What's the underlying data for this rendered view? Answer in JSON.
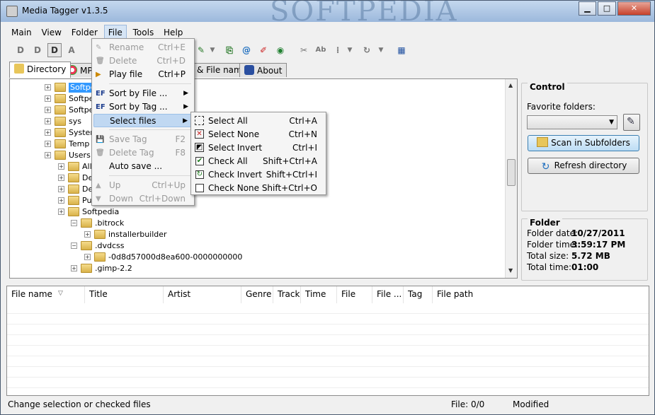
{
  "window": {
    "title": "Media Tagger v1.3.5",
    "watermark": "SOFTPEDIA"
  },
  "menubar": [
    "Main",
    "View",
    "Folder",
    "File",
    "Tools",
    "Help"
  ],
  "tabs": [
    {
      "label": "Directory",
      "icon": "folder-tab-icon"
    },
    {
      "label": "MP",
      "icon": "mp3-tab-icon"
    },
    {
      "label": "& File name",
      "icon": ""
    },
    {
      "label": "About",
      "icon": "gear-icon"
    }
  ],
  "tree": [
    {
      "label": "Softpe",
      "level": 0,
      "selected": true
    },
    {
      "label": "Softpe",
      "level": 0
    },
    {
      "label": "Softpe",
      "level": 0
    },
    {
      "label": "sys",
      "level": 0
    },
    {
      "label": "System",
      "level": 0
    },
    {
      "label": "Temp",
      "level": 0
    },
    {
      "label": "Users",
      "level": 0
    },
    {
      "label": "All",
      "level": 1
    },
    {
      "label": "De",
      "level": 1
    },
    {
      "label": "De",
      "level": 1
    },
    {
      "label": "Pu",
      "level": 1
    },
    {
      "label": "Softpedia",
      "level": 1
    },
    {
      "label": ".bitrock",
      "level": 2
    },
    {
      "label": "installerbuilder",
      "level": 3
    },
    {
      "label": ".dvdcss",
      "level": 2
    },
    {
      "label": "-0d8d57000d8ea600-0000000000",
      "level": 3
    },
    {
      "label": ".gimp-2.2",
      "level": 2
    }
  ],
  "control": {
    "title": "Control",
    "favorite_label": "Favorite folders:",
    "favorite_value": "",
    "scan_button": "Scan in Subfolders",
    "refresh_button": "Refresh directory"
  },
  "folder": {
    "title": "Folder",
    "rows": [
      {
        "label": "Folder date:",
        "value": "10/27/2011"
      },
      {
        "label": "Folder time:",
        "value": "3:59:17 PM"
      },
      {
        "label": "Total size:",
        "value": "5.72 MB"
      },
      {
        "label": "Total time:",
        "value": "01:00"
      }
    ]
  },
  "file_columns": [
    "File name",
    "Title",
    "Artist",
    "Genre",
    "Track",
    "Time",
    "File size",
    "File ...",
    "Tag",
    "File path"
  ],
  "file_menu": [
    {
      "label": "Rename",
      "shortcut": "Ctrl+E",
      "disabled": true
    },
    {
      "label": "Delete",
      "shortcut": "Ctrl+D",
      "disabled": true
    },
    {
      "label": "Play file",
      "shortcut": "Ctrl+P",
      "disabled": false
    },
    {
      "label": "Sort by File ...",
      "shortcut": "",
      "disabled": false,
      "submenu": true
    },
    {
      "label": "Sort by Tag ...",
      "shortcut": "",
      "disabled": false,
      "submenu": true
    },
    {
      "label": "Select files",
      "shortcut": "",
      "disabled": false,
      "submenu": true,
      "highlight": true
    },
    {
      "label": "Save Tag",
      "shortcut": "F2",
      "disabled": true
    },
    {
      "label": "Delete Tag",
      "shortcut": "F8",
      "disabled": true
    },
    {
      "label": "Auto save ...",
      "shortcut": "",
      "disabled": false
    },
    {
      "label": "Up",
      "shortcut": "Ctrl+Up",
      "disabled": true
    },
    {
      "label": "Down",
      "shortcut": "Ctrl+Down",
      "disabled": true
    }
  ],
  "select_submenu": [
    {
      "label": "Select All",
      "shortcut": "Ctrl+A"
    },
    {
      "label": "Select None",
      "shortcut": "Ctrl+N"
    },
    {
      "label": "Select Invert",
      "shortcut": "Ctrl+I"
    },
    {
      "label": "Check All",
      "shortcut": "Shift+Ctrl+A"
    },
    {
      "label": "Check Invert",
      "shortcut": "Shift+Ctrl+I"
    },
    {
      "label": "Check None",
      "shortcut": "Shift+Ctrl+O"
    }
  ],
  "status": {
    "message": "Change selection or checked files",
    "file_count": "File: 0/0",
    "modified": "Modified"
  },
  "colors": {
    "accent": "#3399ff",
    "highlight": "#c0d8f2",
    "folder": "#e8c65a"
  }
}
